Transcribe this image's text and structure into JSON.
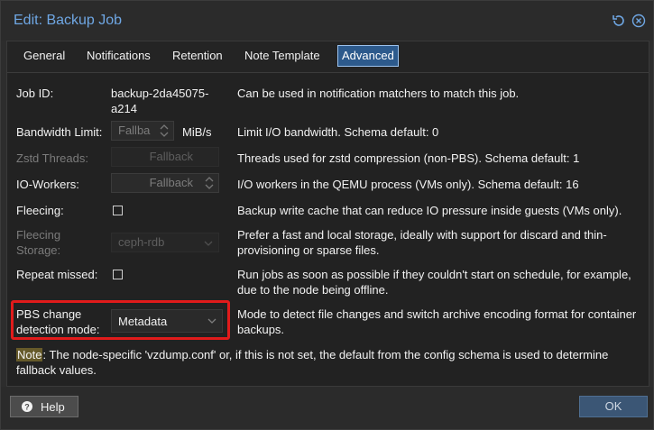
{
  "dialog": {
    "title": "Edit: Backup Job",
    "accent_color": "#6fa7e4",
    "highlight_color": "#e11b1b"
  },
  "tabs": [
    {
      "label": "General"
    },
    {
      "label": "Notifications"
    },
    {
      "label": "Retention"
    },
    {
      "label": "Note Template"
    },
    {
      "label": "Advanced"
    }
  ],
  "rows": {
    "job_id": {
      "label": "Job ID:",
      "value_line1": "backup-2da45075-",
      "value_line2": "a214",
      "desc": "Can be used in notification matchers to match this job."
    },
    "bandwidth": {
      "label": "Bandwidth Limit:",
      "placeholder": "Fallba",
      "unit": "MiB/s",
      "desc": "Limit I/O bandwidth. Schema default: 0"
    },
    "zstd": {
      "label": "Zstd Threads:",
      "placeholder": "Fallback",
      "desc": "Threads used for zstd compression (non-PBS). Schema default: 1"
    },
    "io_workers": {
      "label": "IO-Workers:",
      "placeholder": "Fallback",
      "desc": "I/O workers in the QEMU process (VMs only). Schema default: 16"
    },
    "fleecing": {
      "label": "Fleecing:",
      "desc": "Backup write cache that can reduce IO pressure inside guests (VMs only)."
    },
    "fleecing_storage": {
      "label_line1": "Fleecing",
      "label_line2": "Storage:",
      "value": "ceph-rdb",
      "desc_line1": "Prefer a fast and local storage, ideally with support for discard and thin-",
      "desc_line2": "provisioning or sparse files."
    },
    "repeat_missed": {
      "label": "Repeat missed:",
      "desc_line1": "Run jobs as soon as possible if they couldn't start on schedule, for example,",
      "desc_line2": "due to the node being offline."
    },
    "pbs_mode": {
      "label_line1": "PBS change",
      "label_line2": "detection mode:",
      "value": "Metadata",
      "desc_line1": "Mode to detect file changes and switch archive encoding format for container",
      "desc_line2": "backups."
    }
  },
  "note": {
    "tag": "Note",
    "text_line1": ": The node-specific 'vzdump.conf' or, if this is not set, the default from the config schema is used to determine",
    "text_line2": "fallback values."
  },
  "footer": {
    "help_label": "Help",
    "ok_label": "OK"
  }
}
